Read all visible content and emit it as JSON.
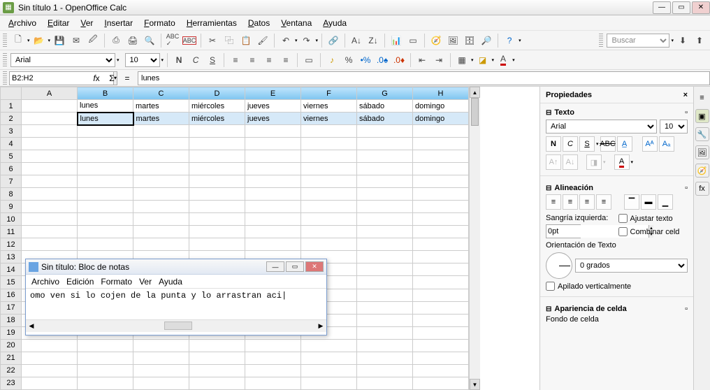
{
  "title": "Sin título 1 - OpenOffice Calc",
  "menu": [
    "Archivo",
    "Editar",
    "Ver",
    "Insertar",
    "Formato",
    "Herramientas",
    "Datos",
    "Ventana",
    "Ayuda"
  ],
  "search_placeholder": "Buscar",
  "font_toolbar": {
    "font": "Arial",
    "size": "10"
  },
  "cell_ref": "B2:H2",
  "formula_value": "lunes",
  "columns": [
    "A",
    "B",
    "C",
    "D",
    "E",
    "F",
    "G",
    "H"
  ],
  "selected_cols": [
    "B",
    "C",
    "D",
    "E",
    "F",
    "G",
    "H"
  ],
  "rows": 23,
  "active_cell": {
    "row": 2,
    "col": "B"
  },
  "selected_row": 2,
  "cells": {
    "1": {
      "B": "lunes",
      "C": "martes",
      "D": "miércoles",
      "E": "jueves",
      "F": "viernes",
      "G": "sábado",
      "H": "domingo"
    },
    "2": {
      "B": "lunes",
      "C": "martes",
      "D": "miércoles",
      "E": "jueves",
      "F": "viernes",
      "G": "sábado",
      "H": "domingo"
    }
  },
  "sidepanel": {
    "title": "Propiedades",
    "text_section": "Texto",
    "font": "Arial",
    "size": "10",
    "align_section": "Alineación",
    "indent_label": "Sangría izquierda:",
    "indent_value": "0pt",
    "wrap_label": "Ajustar texto",
    "merge_label": "Combinar celd",
    "orient_label": "Orientación de Texto",
    "orient_value": "0 grados",
    "stacked_label": "Apilado verticalmente",
    "appearance_section": "Apariencia de celda",
    "bgfill_label": "Fondo de celda"
  },
  "notepad": {
    "title": "Sin título: Bloc de notas",
    "menu": [
      "Archivo",
      "Edición",
      "Formato",
      "Ver",
      "Ayuda"
    ],
    "text": "omo ven si lo cojen de la punta y lo arrastran aci"
  }
}
